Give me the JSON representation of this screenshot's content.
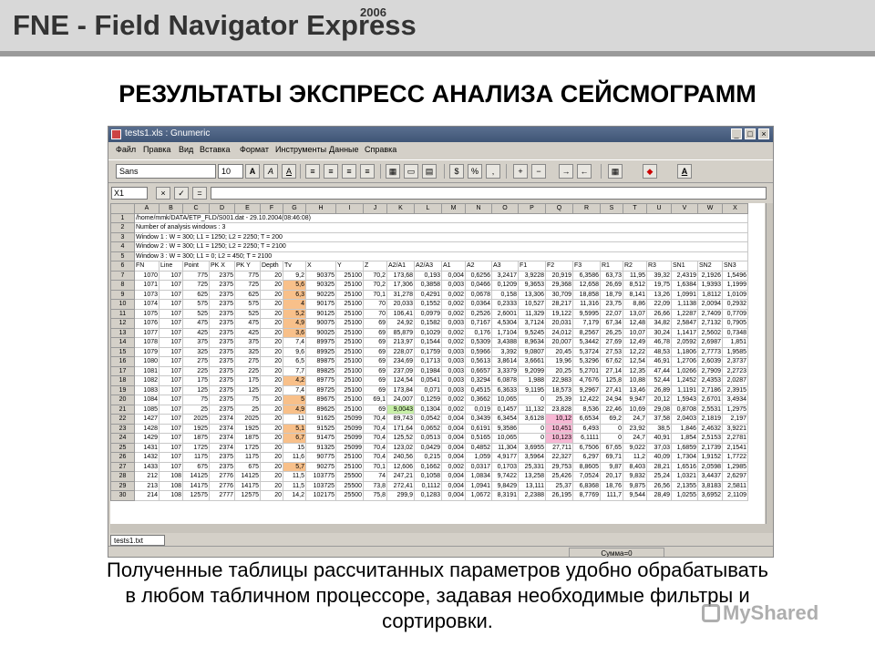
{
  "slide": {
    "header_title": "FNE - Field Navigator Express",
    "header_year": "2006",
    "heading": "РЕЗУЛЬТАТЫ ЭКСПРЕСС АНАЛИЗА СЕЙСМОГРАММ",
    "caption_lines": [
      "Полученные таблицы рассчитанных параметров удобно обрабатывать",
      "в любом табличном процессоре, задавая необходимые фильтры и",
      "сортировки."
    ],
    "watermark": "MyShared"
  },
  "window": {
    "title": "tests1.xls : Gnumeric",
    "buttons": [
      "_",
      "□",
      "×"
    ],
    "menu": [
      "Файл",
      "Правка",
      "Вид",
      "Вставка",
      "Формат",
      "Инструменты",
      "Данные",
      "Справка"
    ],
    "font_name": "Sans",
    "font_size": "10",
    "toolbar_labels": {
      "bold": "A",
      "italic": "A",
      "underline": "A",
      "text_color": "A"
    },
    "cell_ref": "X1",
    "formula_eq": "=",
    "sheet_tab": "tests1.txt",
    "status_sum": "Сумма=0"
  },
  "sheet": {
    "col_headers": [
      "A",
      "B",
      "C",
      "D",
      "E",
      "F",
      "G",
      "H",
      "I",
      "J",
      "K",
      "L",
      "M",
      "N",
      "O",
      "P",
      "Q",
      "R",
      "S",
      "T",
      "U",
      "V",
      "W",
      "X"
    ],
    "rows": [
      {
        "n": "1",
        "text": "/home/mmk/DATA/ETP_FLD/S001.dat - 29.10.2004(08:46:08)"
      },
      {
        "n": "2",
        "text": "Number of analysis windows : 3"
      },
      {
        "n": "3",
        "text": "Window 1 : W = 300; L1 = 1250; L2 = 2250; T = 200"
      },
      {
        "n": "4",
        "text": "Window 2 : W = 300; L1 = 1250; L2 = 2250; T = 2100"
      },
      {
        "n": "5",
        "text": "Window 3 : W = 300; L1 = 0; L2 = 450; T = 2100"
      },
      {
        "n": "6",
        "cells": [
          "FN",
          "Line",
          "Point",
          "PK X",
          "PK Y",
          "Depth",
          "Tv",
          "X",
          "Y",
          "Z",
          "A2/A1",
          "A2/A3",
          "A1",
          "A2",
          "A3",
          "F1",
          "F2",
          "F3",
          "R1",
          "R2",
          "R3",
          "SN1",
          "SN2",
          "SN3"
        ]
      },
      {
        "n": "7",
        "cells": [
          "1070",
          "107",
          "775",
          "2375",
          "775",
          "20",
          "9,2",
          "90375",
          "25100",
          "70,2",
          "173,68",
          "0,193",
          "0,004",
          "0,6256",
          "3,2417",
          "3,9228",
          "20,919",
          "6,3586",
          "63,73",
          "11,95",
          "39,32",
          "2,4319",
          "2,1926",
          "1,5496"
        ]
      },
      {
        "n": "8",
        "cells": [
          "1071",
          "107",
          "725",
          "2375",
          "725",
          "20",
          "5,6",
          "90325",
          "25100",
          "70,2",
          "17,306",
          "0,3858",
          "0,003",
          "0,0466",
          "0,1209",
          "9,3653",
          "29,368",
          "12,658",
          "26,69",
          "8,512",
          "19,75",
          "1,6384",
          "1,9393",
          "1,1999"
        ]
      },
      {
        "n": "9",
        "cells": [
          "1073",
          "107",
          "625",
          "2375",
          "625",
          "20",
          "6,3",
          "90225",
          "25100",
          "70,1",
          "31,278",
          "0,4291",
          "0,002",
          "0,0678",
          "0,158",
          "13,306",
          "30,709",
          "18,858",
          "18,79",
          "8,141",
          "13,26",
          "1,0991",
          "1,8112",
          "1,0109"
        ]
      },
      {
        "n": "10",
        "cells": [
          "1074",
          "107",
          "575",
          "2375",
          "575",
          "20",
          "4",
          "90175",
          "25100",
          "70",
          "20,033",
          "0,1552",
          "0,002",
          "0,0364",
          "0,2333",
          "10,527",
          "28,217",
          "11,316",
          "23,75",
          "8,86",
          "22,09",
          "1,1138",
          "2,0094",
          "0,2932"
        ]
      },
      {
        "n": "11",
        "cells": [
          "1075",
          "107",
          "525",
          "2375",
          "525",
          "20",
          "5,2",
          "90125",
          "25100",
          "70",
          "106,41",
          "0,0979",
          "0,002",
          "0,2526",
          "2,6001",
          "11,329",
          "19,122",
          "9,5995",
          "22,07",
          "13,07",
          "26,66",
          "1,2287",
          "2,7409",
          "0,7709"
        ]
      },
      {
        "n": "12",
        "cells": [
          "1076",
          "107",
          "475",
          "2375",
          "475",
          "20",
          "4,9",
          "90075",
          "25100",
          "69",
          "24,92",
          "0,1582",
          "0,003",
          "0,7167",
          "4,5304",
          "3,7124",
          "20,031",
          "7,179",
          "67,34",
          "12,48",
          "34,82",
          "2,5847",
          "2,7132",
          "0,7905"
        ]
      },
      {
        "n": "13",
        "cells": [
          "1077",
          "107",
          "425",
          "2375",
          "425",
          "20",
          "3,6",
          "90025",
          "25100",
          "69",
          "85,879",
          "0,1029",
          "0,002",
          "0,176",
          "1,7104",
          "9,5245",
          "24,012",
          "8,2567",
          "26,25",
          "10,07",
          "30,24",
          "1,1417",
          "2,5602",
          "0,7348"
        ]
      },
      {
        "n": "14",
        "cells": [
          "1078",
          "107",
          "375",
          "2375",
          "375",
          "20",
          "7,4",
          "89975",
          "25100",
          "69",
          "213,97",
          "0,1544",
          "0,002",
          "0,5309",
          "3,4388",
          "8,9634",
          "20,007",
          "5,3442",
          "27,69",
          "12,49",
          "46,78",
          "2,0592",
          "2,6987",
          "1,851"
        ]
      },
      {
        "n": "15",
        "cells": [
          "1079",
          "107",
          "325",
          "2375",
          "325",
          "20",
          "9,6",
          "89925",
          "25100",
          "69",
          "228,07",
          "0,1759",
          "0,003",
          "0,5966",
          "3,392",
          "9,0807",
          "20,45",
          "5,3724",
          "27,53",
          "12,22",
          "48,53",
          "1,1806",
          "2,7773",
          "1,9585"
        ]
      },
      {
        "n": "16",
        "cells": [
          "1080",
          "107",
          "275",
          "2375",
          "275",
          "20",
          "6,5",
          "89875",
          "25100",
          "69",
          "234,69",
          "0,1713",
          "0,003",
          "0,5613",
          "3,8614",
          "3,6661",
          "19,96",
          "5,3296",
          "67,62",
          "12,54",
          "46,91",
          "1,2706",
          "2,6039",
          "2,3737"
        ]
      },
      {
        "n": "17",
        "cells": [
          "1081",
          "107",
          "225",
          "2375",
          "225",
          "20",
          "7,7",
          "89825",
          "25100",
          "69",
          "237,09",
          "0,1984",
          "0,003",
          "0,6657",
          "3,3379",
          "9,2099",
          "20,25",
          "5,2701",
          "27,14",
          "12,35",
          "47,44",
          "1,0266",
          "2,7909",
          "2,2723"
        ]
      },
      {
        "n": "18",
        "cells": [
          "1082",
          "107",
          "175",
          "2375",
          "175",
          "20",
          "4,2",
          "89775",
          "25100",
          "69",
          "124,54",
          "0,0541",
          "0,003",
          "0,3294",
          "6,0878",
          "1,988",
          "22,983",
          "4,7676",
          "125,8",
          "10,88",
          "52,44",
          "1,2452",
          "2,4353",
          "2,0287"
        ]
      },
      {
        "n": "19",
        "cells": [
          "1083",
          "107",
          "125",
          "2375",
          "125",
          "20",
          "7,4",
          "89725",
          "25100",
          "69",
          "173,84",
          "0,071",
          "0,003",
          "0,4515",
          "6,3633",
          "9,1195",
          "18,573",
          "9,2967",
          "27,41",
          "13,46",
          "26,89",
          "1,1191",
          "2,7186",
          "2,3915"
        ]
      },
      {
        "n": "20",
        "cells": [
          "1084",
          "107",
          "75",
          "2375",
          "75",
          "20",
          "5",
          "89675",
          "25100",
          "69,1",
          "24,007",
          "0,1259",
          "0,002",
          "0,3662",
          "10,065",
          "0",
          "25,39",
          "12,422",
          "24,94",
          "9,947",
          "20,12",
          "1,5943",
          "2,6701",
          "3,4934"
        ]
      },
      {
        "n": "21",
        "cells": [
          "1085",
          "107",
          "25",
          "2375",
          "25",
          "20",
          "4,9",
          "89625",
          "25100",
          "69",
          "9,0043",
          "0,1304",
          "0,002",
          "0,019",
          "0,1457",
          "11,132",
          "23,828",
          "8,536",
          "22,46",
          "10,69",
          "29,08",
          "0,8708",
          "2,5531",
          "1,2975"
        ]
      },
      {
        "n": "22",
        "cells": [
          "1427",
          "107",
          "2025",
          "2374",
          "2025",
          "20",
          "11",
          "91625",
          "25099",
          "70,4",
          "89,743",
          "0,0542",
          "0,004",
          "0,3439",
          "6,3454",
          "3,6128",
          "10,12",
          "6,6534",
          "69,2",
          "24,7",
          "37,58",
          "2,0403",
          "2,1819",
          "2,197"
        ]
      },
      {
        "n": "23",
        "cells": [
          "1428",
          "107",
          "1925",
          "2374",
          "1925",
          "20",
          "5,1",
          "91525",
          "25099",
          "70,4",
          "171,64",
          "0,0652",
          "0,004",
          "0,6191",
          "9,3586",
          "0",
          "10,451",
          "6,493",
          "0",
          "23,92",
          "38,5",
          "1,846",
          "2,4632",
          "3,9221"
        ]
      },
      {
        "n": "24",
        "cells": [
          "1429",
          "107",
          "1875",
          "2374",
          "1875",
          "20",
          "6,7",
          "91475",
          "25099",
          "70,4",
          "125,52",
          "0,0513",
          "0,004",
          "0,5165",
          "10,065",
          "0",
          "10,123",
          "6,1111",
          "0",
          "24,7",
          "40,91",
          "1,854",
          "2,5153",
          "2,2781"
        ]
      },
      {
        "n": "25",
        "cells": [
          "1431",
          "107",
          "1725",
          "2374",
          "1725",
          "20",
          "15",
          "91325",
          "25099",
          "70,4",
          "123,02",
          "0,0429",
          "0,004",
          "0,4852",
          "11,304",
          "3,6955",
          "27,711",
          "6,7506",
          "67,65",
          "9,022",
          "37,03",
          "1,6859",
          "2,1739",
          "2,1541"
        ]
      },
      {
        "n": "26",
        "cells": [
          "1432",
          "107",
          "1175",
          "2375",
          "1175",
          "20",
          "11,6",
          "90775",
          "25100",
          "70,4",
          "240,56",
          "0,215",
          "0,004",
          "1,059",
          "4,9177",
          "3,5964",
          "22,327",
          "6,297",
          "69,71",
          "11,2",
          "40,09",
          "1,7304",
          "1,9152",
          "1,7722"
        ]
      },
      {
        "n": "27",
        "cells": [
          "1433",
          "107",
          "675",
          "2375",
          "675",
          "20",
          "5,7",
          "90275",
          "25100",
          "70,1",
          "12,606",
          "0,1662",
          "0,002",
          "0,0317",
          "0,1703",
          "25,331",
          "29,753",
          "8,8605",
          "9,87",
          "8,403",
          "28,21",
          "1,6516",
          "2,0598",
          "1,2985"
        ]
      },
      {
        "n": "28",
        "cells": [
          "212",
          "108",
          "14125",
          "2776",
          "14125",
          "20",
          "11,5",
          "103775",
          "25500",
          "74",
          "247,21",
          "0,1058",
          "0,004",
          "1,0834",
          "9,7422",
          "13,258",
          "25,426",
          "7,0524",
          "20,17",
          "9,832",
          "25,24",
          "1,0321",
          "3,4437",
          "2,6297"
        ]
      },
      {
        "n": "29",
        "cells": [
          "213",
          "108",
          "14175",
          "2776",
          "14175",
          "20",
          "11,5",
          "103725",
          "25500",
          "73,8",
          "272,41",
          "0,1112",
          "0,004",
          "1,0941",
          "9,8429",
          "13,111",
          "25,37",
          "6,8368",
          "18,76",
          "9,875",
          "26,56",
          "2,1355",
          "3,8183",
          "2,5811"
        ]
      },
      {
        "n": "30",
        "cells": [
          "214",
          "108",
          "12575",
          "2777",
          "12575",
          "20",
          "14,2",
          "102175",
          "25500",
          "75,8",
          "299,9",
          "0,1283",
          "0,004",
          "1,0672",
          "8,3191",
          "2,2388",
          "26,195",
          "8,7769",
          "111,7",
          "9,544",
          "28,49",
          "1,0255",
          "3,6952",
          "2,1109"
        ]
      }
    ]
  }
}
